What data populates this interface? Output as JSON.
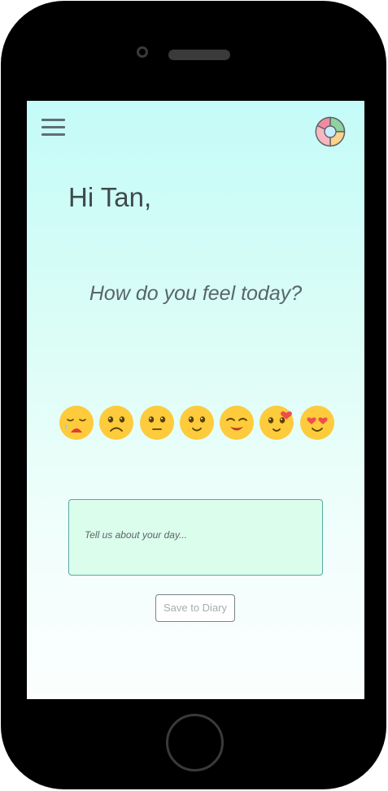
{
  "header": {
    "menu_icon": "hamburger-menu-icon",
    "avatar_icon": "pie-chart-avatar-icon"
  },
  "greeting": "Hi Tan,",
  "question": "How do you feel today?",
  "moods": [
    {
      "icon": "crying-face-icon"
    },
    {
      "icon": "sad-face-icon"
    },
    {
      "icon": "neutral-face-icon"
    },
    {
      "icon": "slight-smile-face-icon"
    },
    {
      "icon": "content-smile-face-icon"
    },
    {
      "icon": "smiling-face-with-heart-icon"
    },
    {
      "icon": "heart-eyes-face-icon"
    }
  ],
  "diary": {
    "placeholder": "Tell us about your day..."
  },
  "save_button": {
    "label": "Save to Diary"
  },
  "colors": {
    "screen_top": "#c4fbf8",
    "screen_bottom": "#fbfffe",
    "emoji_yellow": "#fdcb3b",
    "diary_background": "#dbfdec",
    "diary_border": "#57a9a2",
    "heart_red": "#ef4d4d"
  }
}
